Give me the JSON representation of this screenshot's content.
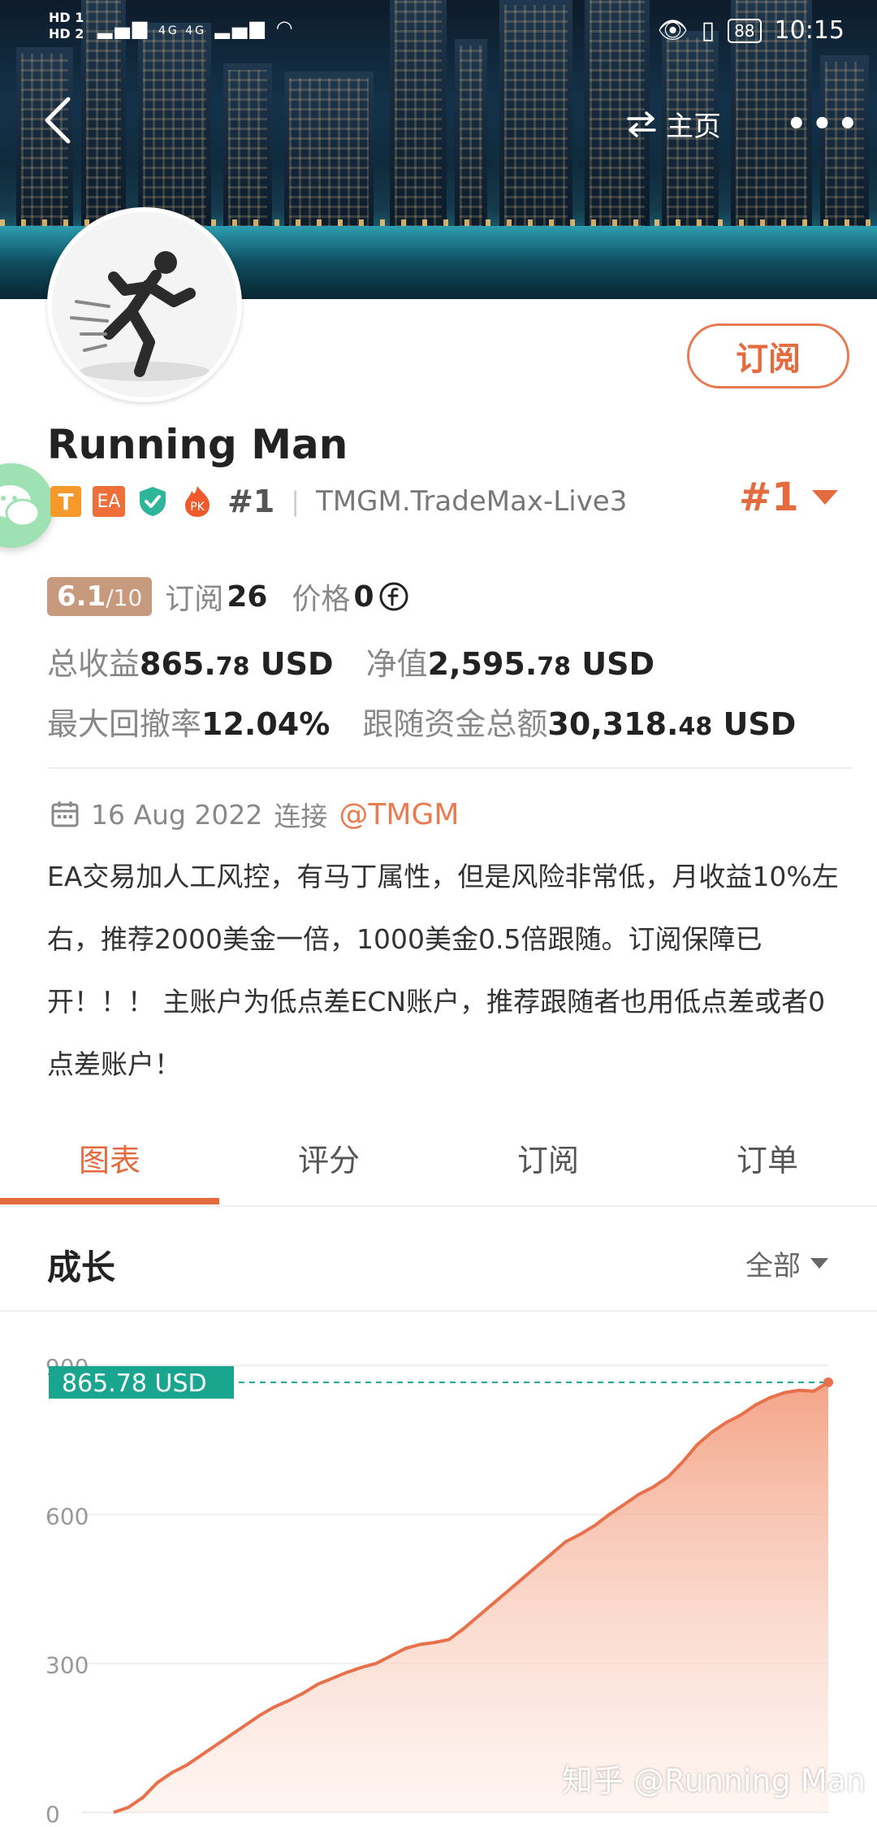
{
  "status_bar": {
    "hd1": "HD 1",
    "hd2": "HD 2",
    "signal": "4G 4G",
    "battery": "88",
    "time": "10:15"
  },
  "nav": {
    "home_label": "主页"
  },
  "profile": {
    "name": "Running Man",
    "subscribe_label": "订阅",
    "badge_t": "T",
    "badge_ea": "EA",
    "badge_pk": "PK",
    "rank_small": "#1",
    "broker": "TMGM.TradeMax-Live3",
    "rank_big": "#1"
  },
  "stats": {
    "score": "6.1",
    "score_max": "/10",
    "subscribers_label": "订阅",
    "subscribers": "26",
    "price_label": "价格",
    "price": "0",
    "total_profit_label": "总收益",
    "total_profit_int": "865.",
    "total_profit_dec": "78",
    "total_profit_unit": " USD",
    "equity_label": "净值",
    "equity_int": "2,595.",
    "equity_dec": "78",
    "equity_unit": " USD",
    "max_drawdown_label": "最大回撤率",
    "max_drawdown": "12.04%",
    "follow_funds_label": "跟随资金总额",
    "follow_funds_int": "30,318.",
    "follow_funds_dec": "48",
    "follow_funds_unit": " USD"
  },
  "meta": {
    "date": "16 Aug 2022",
    "connect": "连接",
    "mention": "@TMGM"
  },
  "description": "EA交易加人工风控，有马丁属性，但是风险非常低，月收益10%左右，推荐2000美金一倍，1000美金0.5倍跟随。订阅保障已开！！！ 主账户为低点差ECN账户，推荐跟随者也用低点差或者0点差账户！",
  "tabs": [
    "图表",
    "评分",
    "订阅",
    "订单"
  ],
  "section": {
    "title": "成长",
    "filter": "全部"
  },
  "chart_data": {
    "type": "area",
    "current_label": "865.78 USD",
    "y_ticks": [
      "900",
      "600",
      "300",
      "0"
    ],
    "ylim": [
      0,
      900
    ],
    "values": [
      0,
      10,
      30,
      60,
      80,
      95,
      115,
      135,
      155,
      175,
      195,
      212,
      225,
      240,
      258,
      270,
      282,
      292,
      300,
      315,
      330,
      338,
      342,
      348,
      370,
      395,
      420,
      445,
      470,
      495,
      520,
      545,
      560,
      578,
      600,
      620,
      640,
      655,
      675,
      705,
      740,
      765,
      785,
      800,
      820,
      835,
      845,
      850,
      848,
      865.78
    ],
    "colors": {
      "line": "#e8704a",
      "fill": "#f6b39b",
      "label_bg": "#1aa58e",
      "ref_line": "#1aa58e"
    }
  },
  "watermark": "知乎 @Running Man"
}
